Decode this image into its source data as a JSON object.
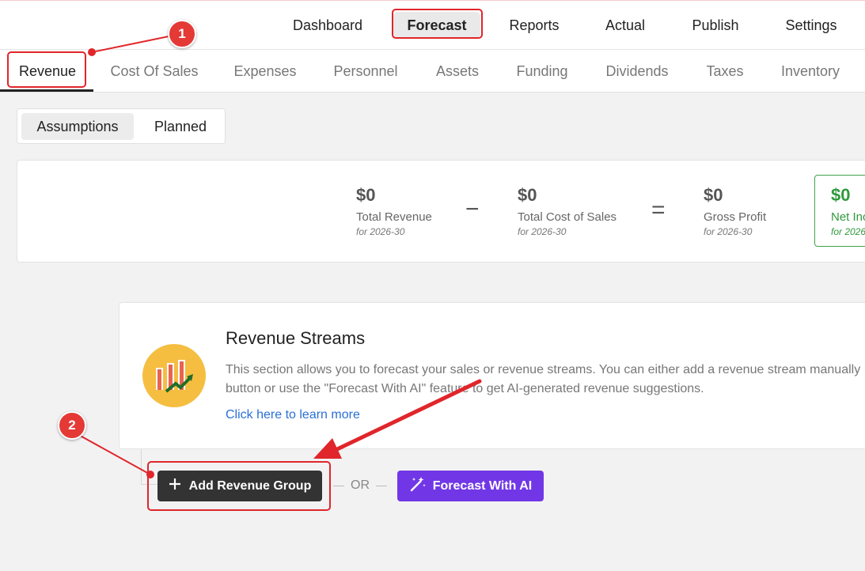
{
  "top_nav": {
    "items": [
      {
        "label": "Dashboard",
        "active": false
      },
      {
        "label": "Forecast",
        "active": true
      },
      {
        "label": "Reports",
        "active": false
      },
      {
        "label": "Actual",
        "active": false
      },
      {
        "label": "Publish",
        "active": false
      },
      {
        "label": "Settings",
        "active": false
      }
    ]
  },
  "sub_nav": {
    "items": [
      {
        "label": "Revenue",
        "active": true
      },
      {
        "label": "Cost Of Sales",
        "active": false
      },
      {
        "label": "Expenses",
        "active": false
      },
      {
        "label": "Personnel",
        "active": false
      },
      {
        "label": "Assets",
        "active": false
      },
      {
        "label": "Funding",
        "active": false
      },
      {
        "label": "Dividends",
        "active": false
      },
      {
        "label": "Taxes",
        "active": false
      },
      {
        "label": "Inventory",
        "active": false
      }
    ]
  },
  "view_toggle": {
    "options": [
      {
        "label": "Assumptions",
        "active": true
      },
      {
        "label": "Planned",
        "active": false
      }
    ]
  },
  "summary": {
    "total_revenue": {
      "value": "$0",
      "label": "Total Revenue",
      "period": "for 2026-30"
    },
    "minus": "−",
    "total_cost_of_sales": {
      "value": "$0",
      "label": "Total Cost of Sales",
      "period": "for 2026-30"
    },
    "equals": "=",
    "gross_profit": {
      "value": "$0",
      "label": "Gross Profit",
      "period": "for 2026-30"
    },
    "net_income": {
      "value": "$0",
      "label": "Net Inc",
      "period": "for 2026"
    }
  },
  "revenue_streams": {
    "icon": "revenue-chart-icon",
    "title": "Revenue Streams",
    "description_line1": "This section allows you to forecast your sales or revenue streams. You can either add a revenue stream manually",
    "description_line2": "button or use the \"Forecast With AI\" feature to get AI-generated revenue suggestions.",
    "learn_more": "Click here to learn more"
  },
  "actions": {
    "add_group": {
      "icon": "plus-icon",
      "label": "Add Revenue Group"
    },
    "or_label": "OR",
    "forecast_ai": {
      "icon": "magic-wand-icon",
      "label": "Forecast With AI",
      "color": "#7137e6"
    }
  },
  "annotations": {
    "step1": "1",
    "step2": "2",
    "color": "#e53936"
  }
}
